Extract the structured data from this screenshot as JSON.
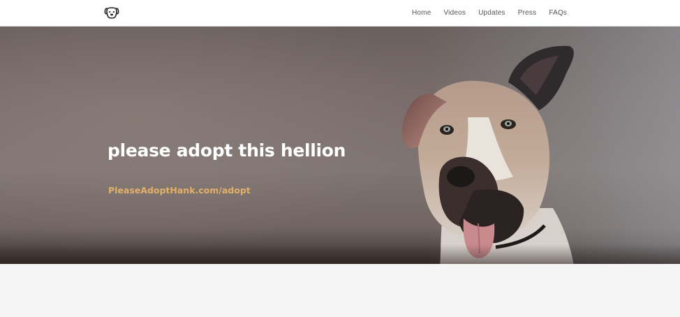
{
  "brand": {
    "logo_icon": "dog-face-icon"
  },
  "nav": {
    "items": [
      {
        "label": "Home"
      },
      {
        "label": "Videos"
      },
      {
        "label": "Updates"
      },
      {
        "label": "Press"
      },
      {
        "label": "FAQs"
      }
    ]
  },
  "hero": {
    "title": "please adopt this hellion",
    "link_text": "PleaseAdoptHank.com/adopt",
    "image": "dog-photo",
    "colors": {
      "title": "#ffffff",
      "link": "#e3b06a",
      "background": "#786d6b"
    }
  }
}
